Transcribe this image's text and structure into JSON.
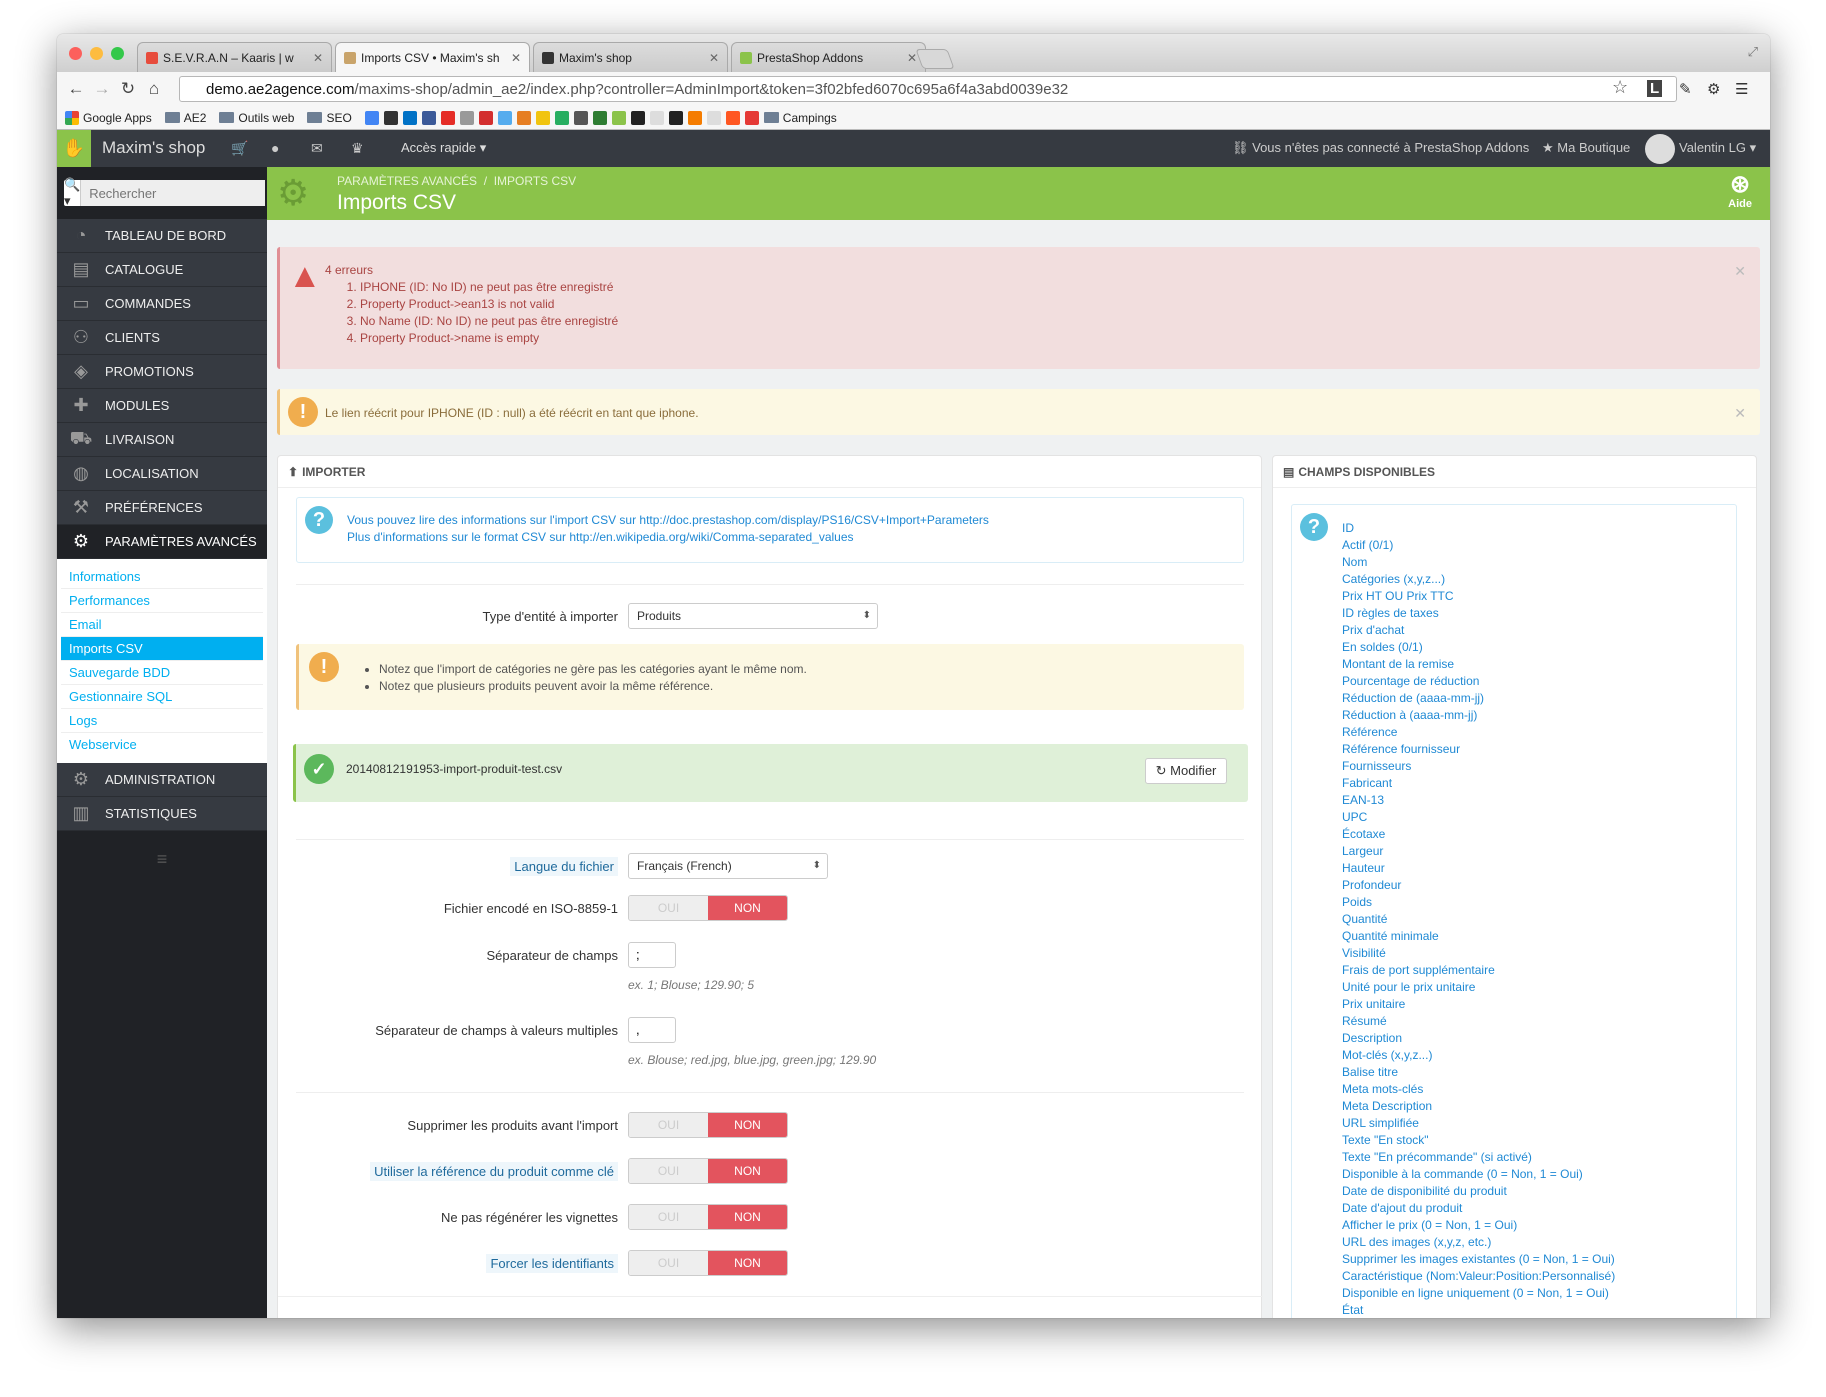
{
  "browser": {
    "tabs": [
      {
        "title": "S.E.V.R.A.N – Kaaris | w",
        "fav": "#e74c3c"
      },
      {
        "title": "Imports CSV • Maxim's sh",
        "fav": "#c9a46b"
      },
      {
        "title": "Maxim's shop",
        "fav": "#333333"
      },
      {
        "title": "PrestaShop Addons",
        "fav": "#8bc34a"
      }
    ],
    "url_host": "demo.ae2agence.com",
    "url_path": "/maxims-shop/admin_ae2/index.php?controller=AdminImport&token=3f02bfed6070c695a6f4a3abd0039e32",
    "bookmarks": [
      "Google Apps",
      "AE2",
      "Outils web",
      "SEO",
      "Campings"
    ]
  },
  "topbar": {
    "shop": "Maxim's shop",
    "quick": "Accès rapide ▾",
    "addons": "Vous n'êtes pas connecté à PrestaShop Addons",
    "boutique": "Ma Boutique",
    "user": "Valentin LG ▾"
  },
  "sidebar": {
    "search_placeholder": "Rechercher",
    "menu": [
      {
        "label": "TABLEAU DE BORD",
        "icon": "dashboard-icon"
      },
      {
        "label": "CATALOGUE",
        "icon": "book-icon"
      },
      {
        "label": "COMMANDES",
        "icon": "credit-card-icon"
      },
      {
        "label": "CLIENTS",
        "icon": "users-icon"
      },
      {
        "label": "PROMOTIONS",
        "icon": "tags-icon"
      },
      {
        "label": "MODULES",
        "icon": "puzzle-icon"
      },
      {
        "label": "LIVRAISON",
        "icon": "truck-icon"
      },
      {
        "label": "LOCALISATION",
        "icon": "globe-icon"
      },
      {
        "label": "PRÉFÉRENCES",
        "icon": "wrench-icon"
      },
      {
        "label": "PARAMÈTRES AVANCÉS",
        "icon": "gears-icon"
      }
    ],
    "submenu": [
      "Informations",
      "Performances",
      "Email",
      "Imports CSV",
      "Sauvegarde BDD",
      "Gestionnaire SQL",
      "Logs",
      "Webservice"
    ],
    "menu2": [
      {
        "label": "ADMINISTRATION",
        "icon": "gear-icon"
      },
      {
        "label": "STATISTIQUES",
        "icon": "bar-chart-icon"
      }
    ]
  },
  "header": {
    "crumb1": "Paramètres avancés",
    "crumb2": "Imports CSV",
    "title": "Imports CSV",
    "help": "Aide"
  },
  "errors": {
    "title": "4 erreurs",
    "items": [
      "IPHONE (ID: No ID) ne peut pas être enregistré",
      "Property Product->ean13 is not valid",
      "No Name (ID: No ID) ne peut pas être enregistré",
      "Property Product->name is empty"
    ]
  },
  "warning": "Le lien réécrit pour IPHONE (ID : null) a été réécrit en tant que iphone.",
  "importer": {
    "title": "IMPORTER",
    "info1": "Vous pouvez lire des informations sur l'import CSV sur http://doc.prestashop.com/display/PS16/CSV+Import+Parameters",
    "info2": "Plus d'informations sur le format CSV sur http://en.wikipedia.org/wiki/Comma-separated_values",
    "entity_label": "Type d'entité à importer",
    "entity_value": "Produits",
    "notes": [
      "Notez que l'import de catégories ne gère pas les catégories ayant le même nom.",
      "Notez que plusieurs produits peuvent avoir la même référence."
    ],
    "file": "20140812191953-import-produit-test.csv",
    "modify": "Modifier",
    "lang_label": "Langue du fichier",
    "lang_value": "Français (French)",
    "iso_label": "Fichier encodé en ISO-8859-1",
    "sep_label": "Séparateur de champs",
    "sep_value": ";",
    "sep_ex": "ex. 1; Blouse; 129.90; 5",
    "msep_label": "Séparateur de champs à valeurs multiples",
    "msep_value": ",",
    "msep_ex": "ex. Blouse; red.jpg, blue.jpg, green.jpg; 129.90",
    "del_label": "Supprimer les produits avant l'import",
    "ref_label": "Utiliser la référence du produit comme clé",
    "thumb_label": "Ne pas régénérer les vignettes",
    "ids_label": "Forcer les identifiants",
    "yes": "OUI",
    "no": "NON"
  },
  "fields": {
    "title": "CHAMPS DISPONIBLES",
    "items": [
      "ID",
      "Actif (0/1)",
      "Nom",
      "Catégories (x,y,z...)",
      "Prix HT OU Prix TTC",
      "ID règles de taxes",
      "Prix d'achat",
      "En soldes (0/1)",
      "Montant de la remise",
      "Pourcentage de réduction",
      "Réduction de (aaaa-mm-jj)",
      "Réduction à (aaaa-mm-jj)",
      "Référence",
      "Référence fournisseur",
      "Fournisseurs",
      "Fabricant",
      "EAN-13",
      "UPC",
      "Écotaxe",
      "Largeur",
      "Hauteur",
      "Profondeur",
      "Poids",
      "Quantité",
      "Quantité minimale",
      "Visibilité",
      "Frais de port supplémentaire",
      "Unité pour le prix unitaire",
      "Prix unitaire",
      "Résumé",
      "Description",
      "Mot-clés (x,y,z...)",
      "Balise titre",
      "Meta mots-clés",
      "Meta Description",
      "URL simplifiée",
      "Texte \"En stock\"",
      "Texte \"En précommande\" (si activé)",
      "Disponible à la commande (0 = Non, 1 = Oui)",
      "Date de disponibilité du produit",
      "Date d'ajout du produit",
      "Afficher le prix (0 = Non, 1 = Oui)",
      "URL des images (x,y,z, etc.)",
      "Supprimer les images existantes (0 = Non, 1 = Oui)",
      "Caractéristique (Nom:Valeur:Position:Personnalisé)",
      "Disponible en ligne uniquement (0 = Non, 1 = Oui)",
      "État"
    ]
  }
}
